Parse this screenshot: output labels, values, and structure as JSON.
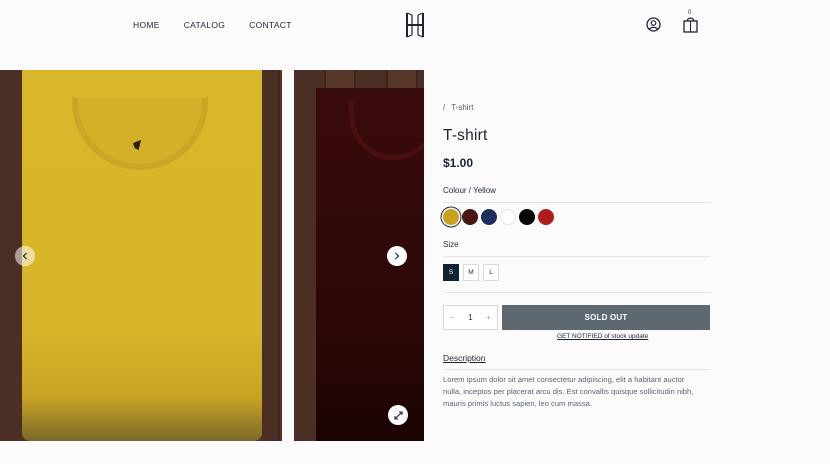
{
  "header": {
    "nav": [
      "HOME",
      "CATALOG",
      "CONTACT"
    ],
    "cart_count": "0"
  },
  "gallery": {
    "slides": [
      "yellow-tshirt",
      "maroon-tshirt"
    ]
  },
  "product": {
    "breadcrumb_sep": "/",
    "breadcrumb": "T-shirt",
    "title": "T-shirt",
    "price": "$1.00",
    "colour_label": "Colour / Yellow",
    "colours": [
      "#c8a21f",
      "#4a1515",
      "#1d2f5c",
      "#ffffff",
      "#050505",
      "#b01c1c"
    ],
    "selected_colour": "#c8a21f",
    "size_label": "Size",
    "sizes": [
      "S",
      "M",
      "L"
    ],
    "selected_size": "S",
    "qty_minus": "−",
    "qty": "1",
    "qty_plus": "+",
    "sold_out": "SOLD OUT",
    "notify": "GET NOTIFIED of stock update",
    "description_tab": "Description",
    "description": "Lorem ipsum dolor sit amet consectetur adipiscing, elit a habitant auctor nulla, inceptos per placerat arcu dis. Est convallis quisque sollicitudin nibh, mauris primis luctus sapien, leo cum massa."
  },
  "icons": {
    "logo": "h-logo-icon",
    "account": "user-icon",
    "cart": "bag-icon",
    "prev": "chevron-left-icon",
    "next": "chevron-right-icon",
    "zoom": "expand-icon"
  }
}
